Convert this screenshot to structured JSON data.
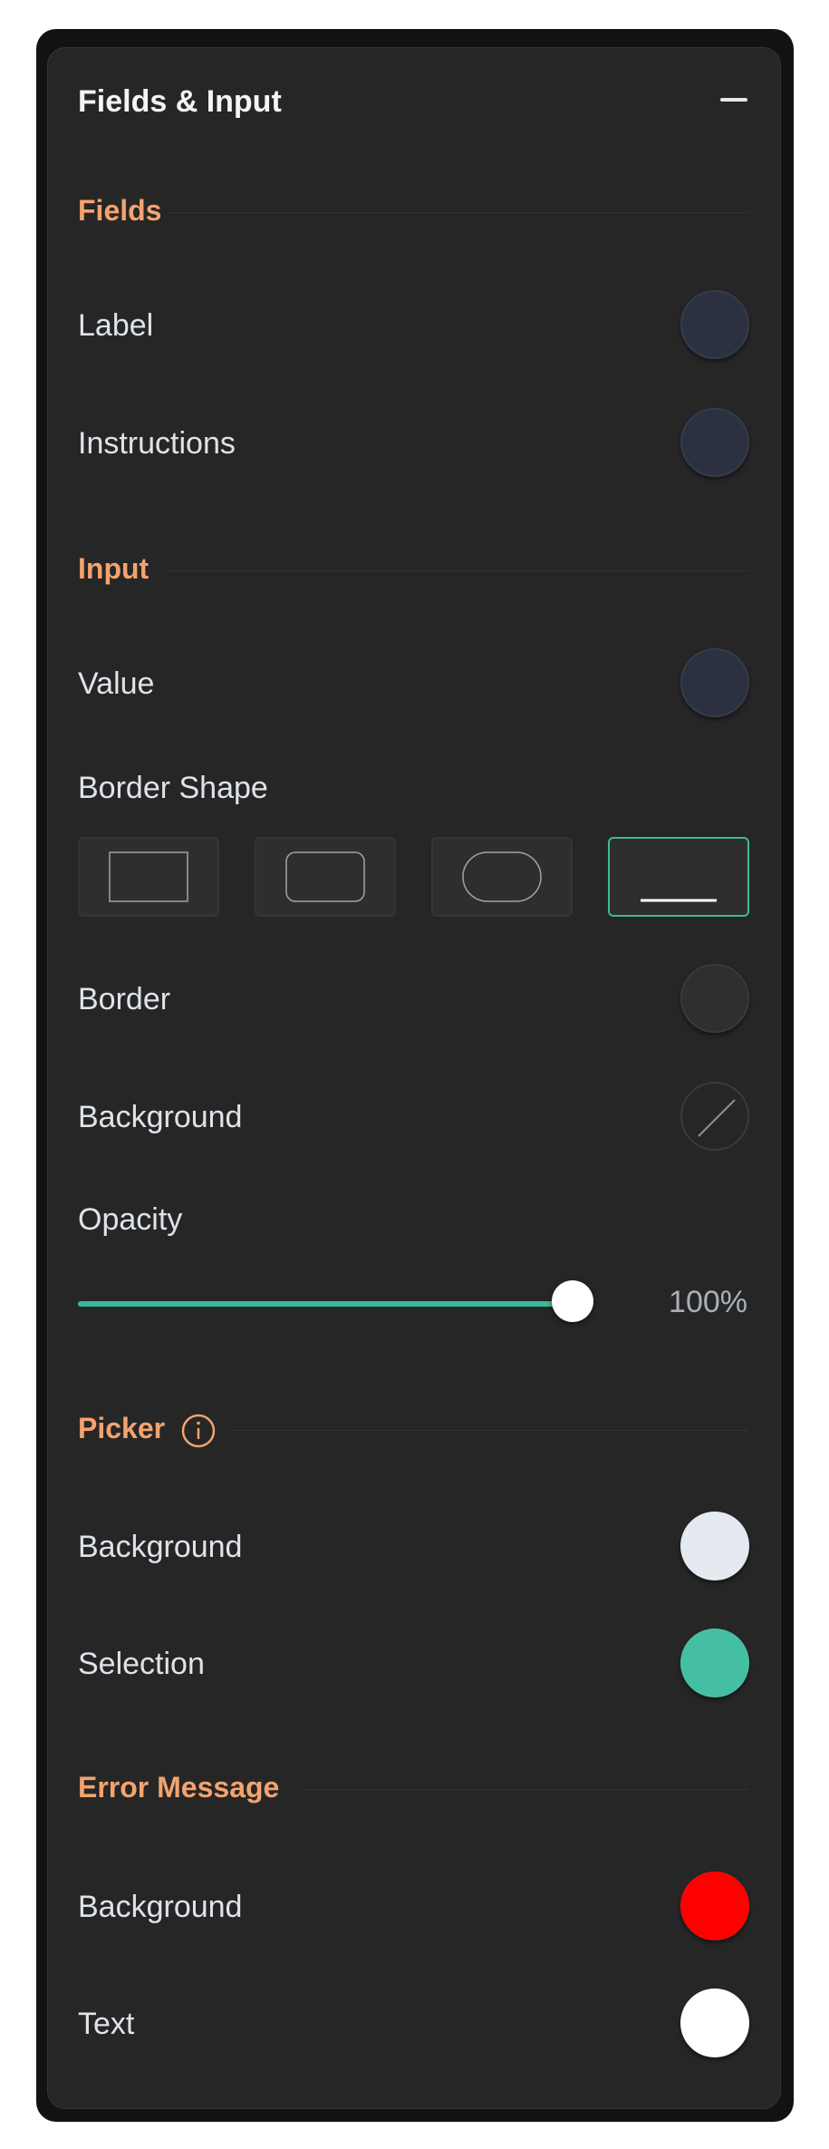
{
  "panel": {
    "title": "Fields & Input",
    "collapse_icon": "minus-icon"
  },
  "sections": {
    "fields": {
      "label": "Fields",
      "rows": [
        {
          "label": "Label",
          "color": "#2b3140"
        },
        {
          "label": "Instructions",
          "color": "#2b3140"
        }
      ]
    },
    "input": {
      "label": "Input",
      "value": {
        "label": "Value",
        "color": "#2b3140"
      },
      "border_shape": {
        "label": "Border Shape",
        "options": [
          "rectangle",
          "rounded",
          "pill",
          "underline"
        ],
        "selected": "underline"
      },
      "border": {
        "label": "Border",
        "color": "#2f2f2f"
      },
      "background": {
        "label": "Background",
        "color": "transparent"
      },
      "opacity": {
        "label": "Opacity",
        "value": 100,
        "display": "100%"
      }
    },
    "picker": {
      "label": "Picker",
      "info_icon": "info-circle-icon",
      "rows": [
        {
          "label": "Background",
          "color": "#e5e9f0"
        },
        {
          "label": "Selection",
          "color": "#45bfa3"
        }
      ]
    },
    "error_message": {
      "label": "Error Message",
      "rows": [
        {
          "label": "Background",
          "color": "#ff0000"
        },
        {
          "label": "Text",
          "color": "#ffffff"
        }
      ]
    }
  },
  "colors": {
    "accent": "#3cb89b",
    "section_heading": "#f4a36f",
    "panel_bg": "#262626"
  }
}
